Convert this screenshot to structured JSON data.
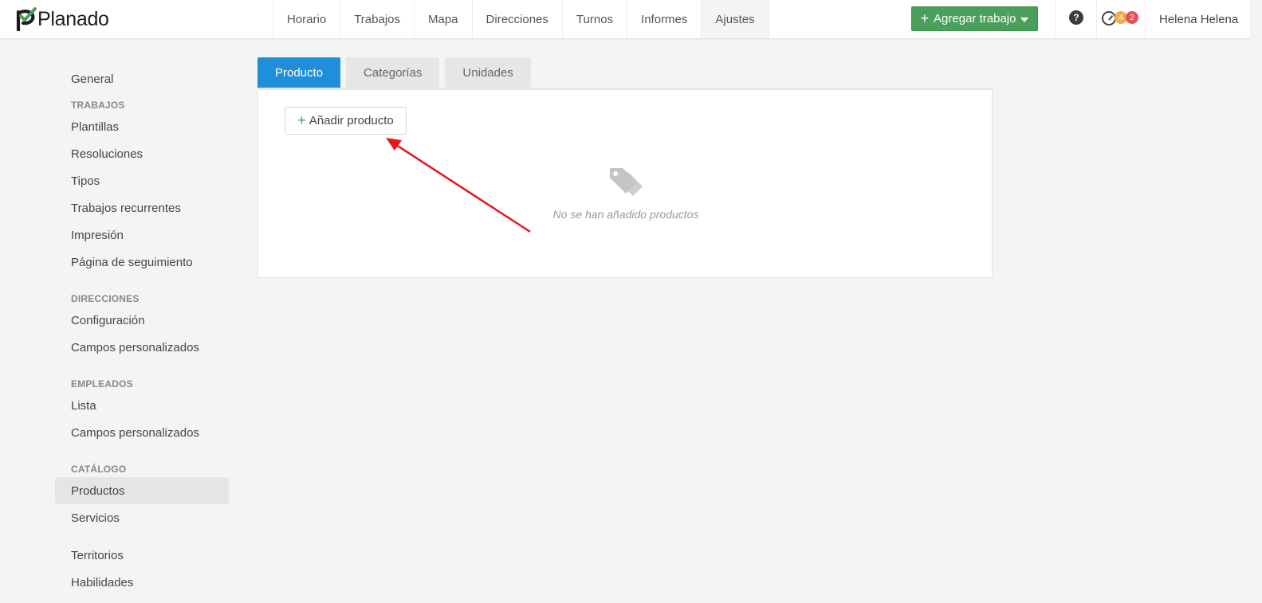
{
  "app": {
    "name": "Planado"
  },
  "nav": [
    {
      "label": "Horario"
    },
    {
      "label": "Trabajos"
    },
    {
      "label": "Mapa"
    },
    {
      "label": "Direcciones"
    },
    {
      "label": "Turnos"
    },
    {
      "label": "Informes"
    },
    {
      "label": "Ajustes",
      "active": true
    }
  ],
  "header": {
    "add_job_label": "Agregar trabajo",
    "help_label": "?",
    "notif_badge_1": "4",
    "notif_badge_2": "2",
    "user_name": "Helena Helena"
  },
  "sidebar": {
    "general": "General",
    "sections": [
      {
        "heading": "TRABAJOS",
        "items": [
          "Plantillas",
          "Resoluciones",
          "Tipos",
          "Trabajos recurrentes",
          "Impresión",
          "Página de seguimiento"
        ]
      },
      {
        "heading": "DIRECCIONES",
        "items": [
          "Configuración",
          "Campos personalizados"
        ]
      },
      {
        "heading": "EMPLEADOS",
        "items": [
          "Lista",
          "Campos personalizados"
        ]
      },
      {
        "heading": "CATÁLOGO",
        "items": [
          "Productos",
          "Servicios"
        ]
      }
    ],
    "extra": [
      "Territorios",
      "Habilidades"
    ],
    "active_item": "Productos"
  },
  "tabs": [
    {
      "label": "Producto",
      "active": true
    },
    {
      "label": "Categorías"
    },
    {
      "label": "Unidades"
    }
  ],
  "panel": {
    "add_product_label": "Añadir producto",
    "empty_text": "No se han añadido productos"
  },
  "colors": {
    "brand_green": "#4aa05a",
    "tab_active": "#1f8fd9",
    "annotation_arrow": "#e8151b"
  }
}
